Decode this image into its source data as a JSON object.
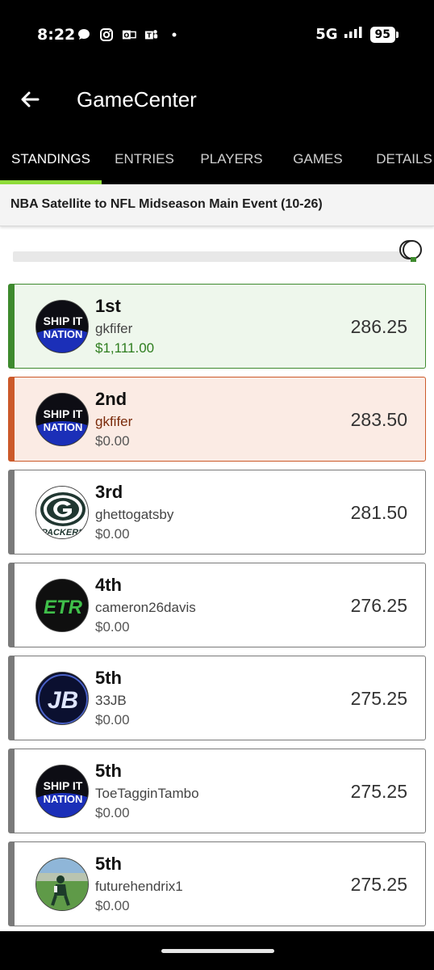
{
  "status_bar": {
    "time": "8:22",
    "network": "5G",
    "battery": "95",
    "icons": [
      "chat-bubble-icon",
      "instagram-icon",
      "outlook-icon",
      "teams-icon",
      "dot-icon",
      "signal-icon",
      "battery-icon"
    ]
  },
  "app_bar": {
    "title": "GameCenter",
    "back_icon": "arrow-left-icon"
  },
  "tabs": [
    {
      "label": "STANDINGS",
      "active": true
    },
    {
      "label": "ENTRIES"
    },
    {
      "label": "PLAYERS"
    },
    {
      "label": "GAMES"
    },
    {
      "label": "DETAILS"
    }
  ],
  "contest": {
    "title": "NBA Satellite to NFL Midseason Main Event (10-26)"
  },
  "colors": {
    "accent": "#8fdc3a",
    "first_border": "#3e8a2e",
    "first_bg": "#eef7ec",
    "second_border": "#cc5a2a",
    "second_bg": "#fbebe4",
    "prize_green": "#2e7d1e"
  },
  "entries": [
    {
      "rank": "1st",
      "user": "gkfifer",
      "prize": "$1,111.00",
      "score": "286.25",
      "avatar": "ship-it-nation-logo",
      "avatar_text": [
        "SHIP IT",
        "NATION"
      ]
    },
    {
      "rank": "2nd",
      "user": "gkfifer",
      "prize": "$0.00",
      "score": "283.50",
      "avatar": "ship-it-nation-logo",
      "avatar_text": [
        "SHIP IT",
        "NATION"
      ]
    },
    {
      "rank": "3rd",
      "user": "ghettogatsby",
      "prize": "$0.00",
      "score": "281.50",
      "avatar": "packers-logo",
      "avatar_text": [
        "PACKERS"
      ]
    },
    {
      "rank": "4th",
      "user": "cameron26davis",
      "prize": "$0.00",
      "score": "276.25",
      "avatar": "etr-logo",
      "avatar_text": [
        "ETR"
      ]
    },
    {
      "rank": "5th",
      "user": "33JB",
      "prize": "$0.00",
      "score": "275.25",
      "avatar": "jb-logo",
      "avatar_text": [
        "JB"
      ]
    },
    {
      "rank": "5th",
      "user": "ToeTagginTambo",
      "prize": "$0.00",
      "score": "275.25",
      "avatar": "ship-it-nation-logo",
      "avatar_text": [
        "SHIP IT",
        "NATION"
      ]
    },
    {
      "rank": "5th",
      "user": "futurehendrix1",
      "prize": "$0.00",
      "score": "275.25",
      "avatar": "football-player-photo"
    }
  ]
}
